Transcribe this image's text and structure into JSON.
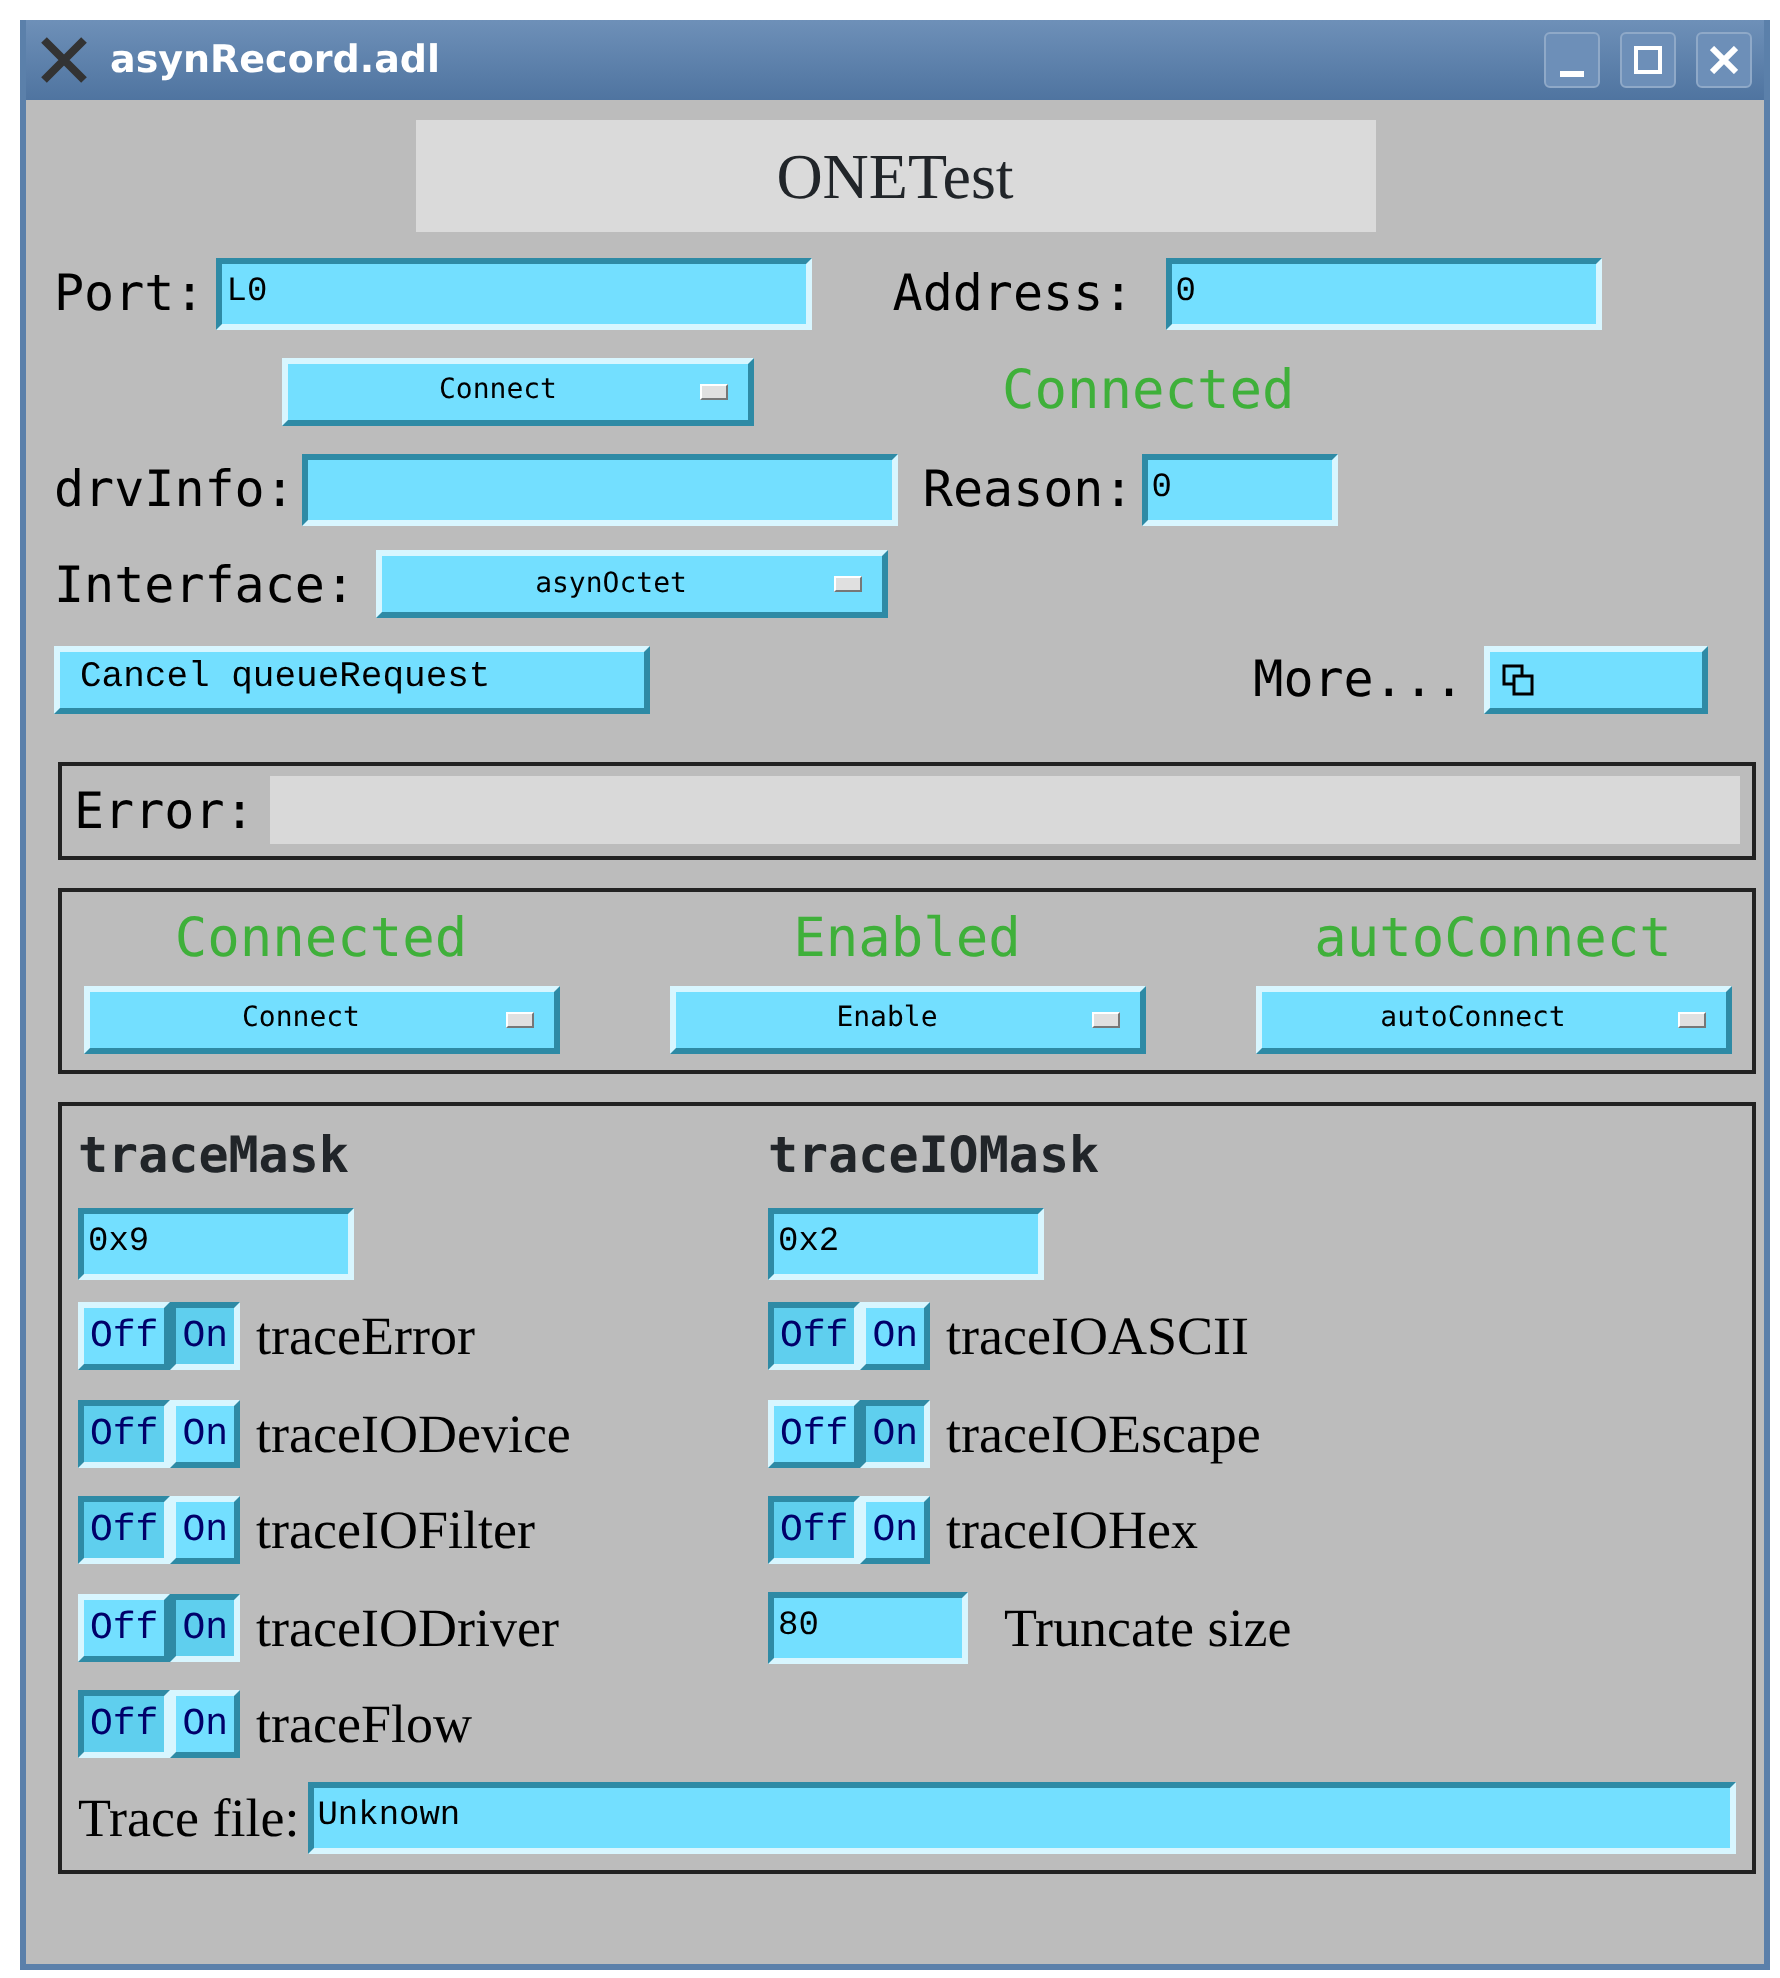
{
  "window": {
    "title": "asynRecord.adl"
  },
  "header": "ONETest",
  "port": {
    "label": "Port:",
    "value": "L0"
  },
  "address": {
    "label": "Address:",
    "value": "0"
  },
  "connect_menu": {
    "value": "Connect"
  },
  "connection_status": "Connected",
  "drv_info": {
    "label": "drvInfo:"
  },
  "reason": {
    "label": "Reason:",
    "value": "0"
  },
  "interface": {
    "label": "Interface:",
    "value": "asynOctet"
  },
  "cancel_button": "Cancel queueRequest",
  "more": {
    "label": "More..."
  },
  "error": {
    "label": "Error:"
  },
  "controls": [
    {
      "status": "Connected",
      "menu": "Connect"
    },
    {
      "status": "Enabled",
      "menu": "Enable"
    },
    {
      "status": "autoConnect",
      "menu": "autoConnect"
    }
  ],
  "trace": {
    "columns": [
      {
        "title": "traceMask",
        "value": "0x9",
        "bits": [
          {
            "off": "Off",
            "on_label": "On",
            "label": "traceError",
            "on": true
          },
          {
            "off": "Off",
            "on_label": "On",
            "label": "traceIODevice",
            "on": false
          },
          {
            "off": "Off",
            "on_label": "On",
            "label": "traceIOFilter",
            "on": false
          },
          {
            "off": "Off",
            "on_label": "On",
            "label": "traceIODriver",
            "on": true
          },
          {
            "off": "Off",
            "on_label": "On",
            "label": "traceFlow",
            "on": false
          }
        ]
      },
      {
        "title": "traceIOMask",
        "value": "0x2",
        "bits": [
          {
            "off": "Off",
            "on_label": "On",
            "label": "traceIOASCII",
            "on": false
          },
          {
            "off": "Off",
            "on_label": "On",
            "label": "traceIOEscape",
            "on": true
          },
          {
            "off": "Off",
            "on_label": "On",
            "label": "traceIOHex",
            "on": false
          }
        ],
        "truncate": {
          "value": "80",
          "label": "Truncate size"
        }
      }
    ],
    "trace_file": {
      "label": "Trace file:",
      "value": "Unknown"
    }
  }
}
